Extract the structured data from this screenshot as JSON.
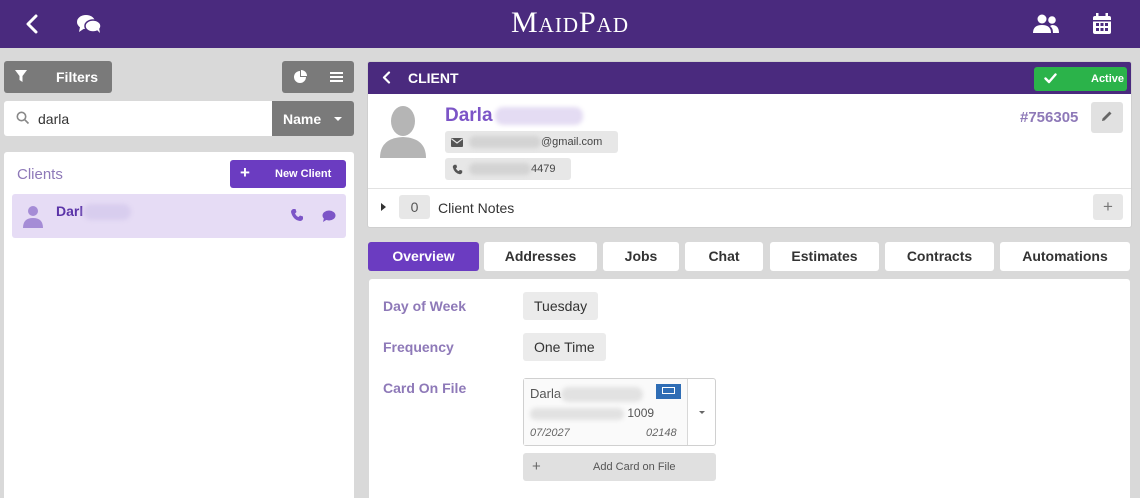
{
  "topbar": {
    "brand": "MaidPad",
    "icons": [
      "back-chevron-icon",
      "chat-bubbles-icon",
      "users-icon",
      "calendar-icon"
    ]
  },
  "sidebar": {
    "filters_label": "Filters",
    "search": {
      "value": "darla",
      "placeholder": ""
    },
    "sort_select": "Name",
    "clients_title": "Clients",
    "new_client_label": "New Client",
    "clients": [
      {
        "name": "Darl"
      }
    ]
  },
  "client": {
    "header_title": "CLIENT",
    "status": "Active",
    "first_name": "Darla",
    "email_suffix": "@gmail.com",
    "phone_suffix": "4479",
    "id": "#756305",
    "notes_count": "0",
    "notes_label": "Client Notes",
    "notes_add": "+"
  },
  "tabs": [
    {
      "label": "Overview",
      "active": true
    },
    {
      "label": "Addresses",
      "active": false
    },
    {
      "label": "Jobs",
      "active": false
    },
    {
      "label": "Chat",
      "active": false
    },
    {
      "label": "Estimates",
      "active": false
    },
    {
      "label": "Contracts",
      "active": false
    },
    {
      "label": "Automations",
      "active": false
    }
  ],
  "overview": {
    "day_of_week_label": "Day of Week",
    "day_of_week_value": "Tuesday",
    "frequency_label": "Frequency",
    "frequency_value": "One Time",
    "card_on_file_label": "Card On File",
    "card": {
      "name": "Darla",
      "last4": "1009",
      "expiry": "07/2027",
      "zip": "02148"
    },
    "add_card_label": "Add Card on File"
  },
  "colors": {
    "brand_purple": "#4a2a7e",
    "accent_purple": "#6b3cc1",
    "label_purple": "#8e79b8",
    "active_green": "#2bb34a"
  }
}
